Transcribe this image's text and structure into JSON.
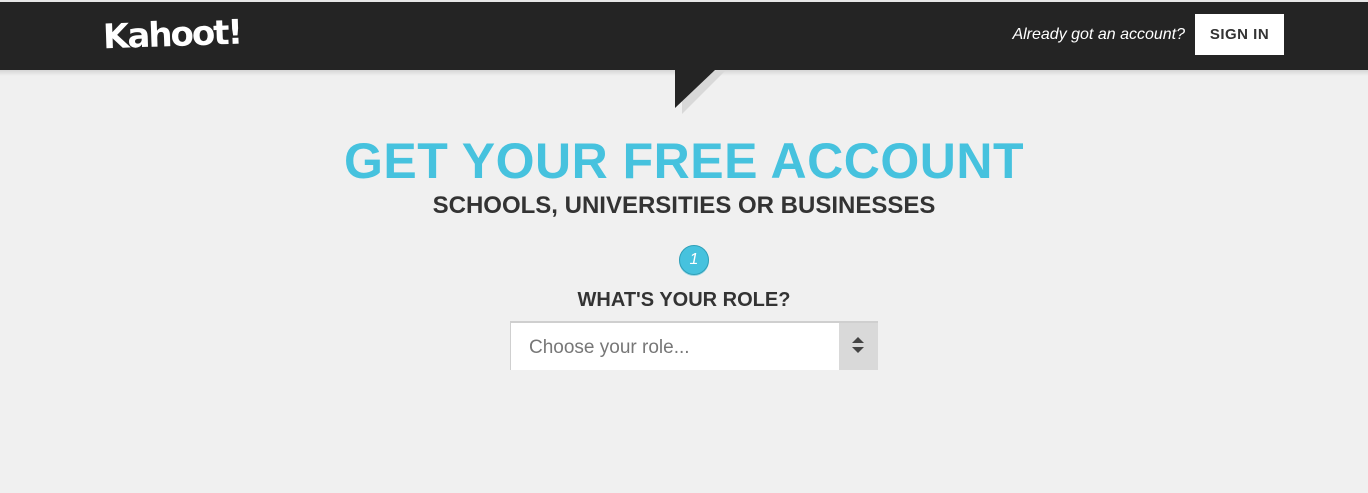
{
  "header": {
    "logo_text": "Kahoot!",
    "account_prompt": "Already got an account?",
    "signin_label": "SIGN IN"
  },
  "main": {
    "title": "GET YOUR FREE ACCOUNT",
    "subtitle": "SCHOOLS, UNIVERSITIES OR BUSINESSES",
    "step_number": "1",
    "role_question": "WHAT'S YOUR ROLE?",
    "role_select": {
      "placeholder": "Choose your role...",
      "icon": "updown-arrows-icon"
    }
  },
  "colors": {
    "header_bg": "#242424",
    "accent": "#46c2de",
    "page_bg": "#f0f0f0",
    "text_dark": "#333333"
  }
}
